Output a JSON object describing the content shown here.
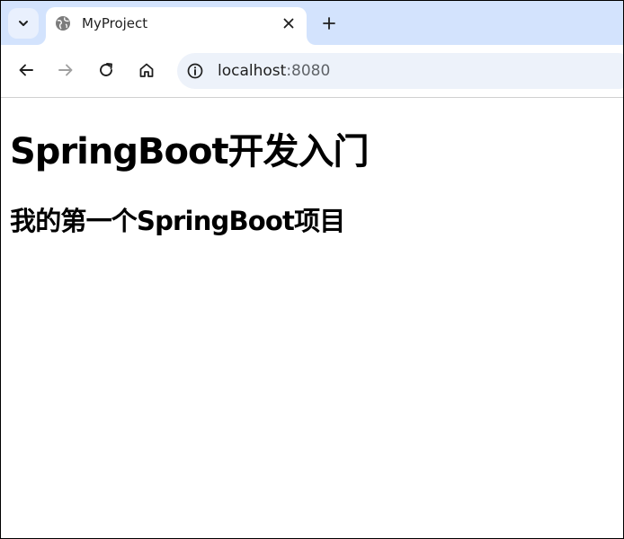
{
  "browser": {
    "tab": {
      "title": "MyProject",
      "favicon": "globe-icon"
    },
    "address_bar": {
      "host": "localhost",
      "port": ":8080",
      "info_icon": "info-icon"
    },
    "colors": {
      "tabstrip_bg": "#d3e3fd",
      "omnibox_bg": "#edf2fa"
    }
  },
  "page": {
    "heading1": "SpringBoot开发入门",
    "heading2": "我的第一个SpringBoot项目"
  }
}
